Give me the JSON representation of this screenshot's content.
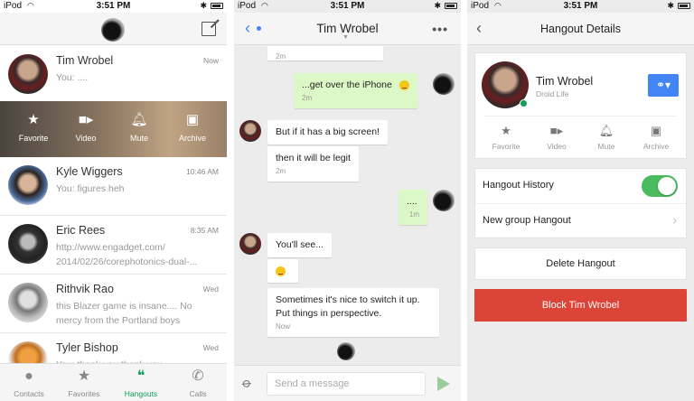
{
  "status_bar": {
    "carrier": "iPod",
    "time": "3:51 PM"
  },
  "conversation_list": {
    "conversations": [
      {
        "name": "Tim Wrobel",
        "time": "Now",
        "preview": "You: ...."
      },
      {
        "name": "Kyle Wiggers",
        "time": "10:46 AM",
        "preview": "You: figures heh"
      },
      {
        "name": "Eric Rees",
        "time": "8:35 AM",
        "preview": "http://www.engadget.com/ 2014/02/26/corephotonics-dual-..."
      },
      {
        "name": "Rithvik Rao",
        "time": "Wed",
        "preview": "this Blazer game is insane.... No mercy from the Portland boys"
      },
      {
        "name": "Tyler Bishop",
        "time": "Wed",
        "preview": "You: thank you thank you"
      }
    ],
    "swipe_actions": [
      {
        "label": "Favorite",
        "icon": "star-icon"
      },
      {
        "label": "Video",
        "icon": "video-camera-icon"
      },
      {
        "label": "Mute",
        "icon": "bell-icon"
      },
      {
        "label": "Archive",
        "icon": "archive-icon"
      }
    ],
    "tabs": [
      {
        "label": "Contacts",
        "icon": "person-icon"
      },
      {
        "label": "Favorites",
        "icon": "star-icon"
      },
      {
        "label": "Hangouts",
        "icon": "hangouts-icon",
        "active": true
      },
      {
        "label": "Calls",
        "icon": "phone-icon"
      }
    ]
  },
  "chat": {
    "title": "Tim Wrobel",
    "messages": [
      {
        "from": "me",
        "text": "...get over the iPhone",
        "time": "2m",
        "emoji": true
      },
      {
        "from": "them",
        "text": "But if it has a big screen!"
      },
      {
        "from": "them",
        "text": "then it will be legit",
        "time": "2m"
      },
      {
        "from": "me",
        "text": "....",
        "time": "1m"
      },
      {
        "from": "them",
        "text": "You'll see..."
      },
      {
        "from": "them",
        "emoji": true
      },
      {
        "from": "them",
        "text": "Sometimes it's nice to switch it up. Put things in perspective.",
        "time": "Now"
      }
    ],
    "partial_top": {
      "time": "2m"
    },
    "composer_placeholder": "Send a message"
  },
  "details": {
    "title": "Hangout Details",
    "contact_name": "Tim Wrobel",
    "contact_subtitle": "Droid Life",
    "actions": [
      {
        "label": "Favorite",
        "icon": "star-icon"
      },
      {
        "label": "Video",
        "icon": "video-camera-icon"
      },
      {
        "label": "Mute",
        "icon": "bell-icon"
      },
      {
        "label": "Archive",
        "icon": "archive-icon"
      }
    ],
    "hangout_history_label": "Hangout History",
    "hangout_history_on": true,
    "new_group_label": "New group Hangout",
    "delete_label": "Delete Hangout",
    "block_label": "Block Tim Wrobel"
  },
  "colors": {
    "hangouts_green": "#0f9d58",
    "link_blue": "#4285f4",
    "block_red": "#db4437",
    "toggle_green": "#4cbb5f",
    "my_bubble": "#dcf8c6"
  }
}
